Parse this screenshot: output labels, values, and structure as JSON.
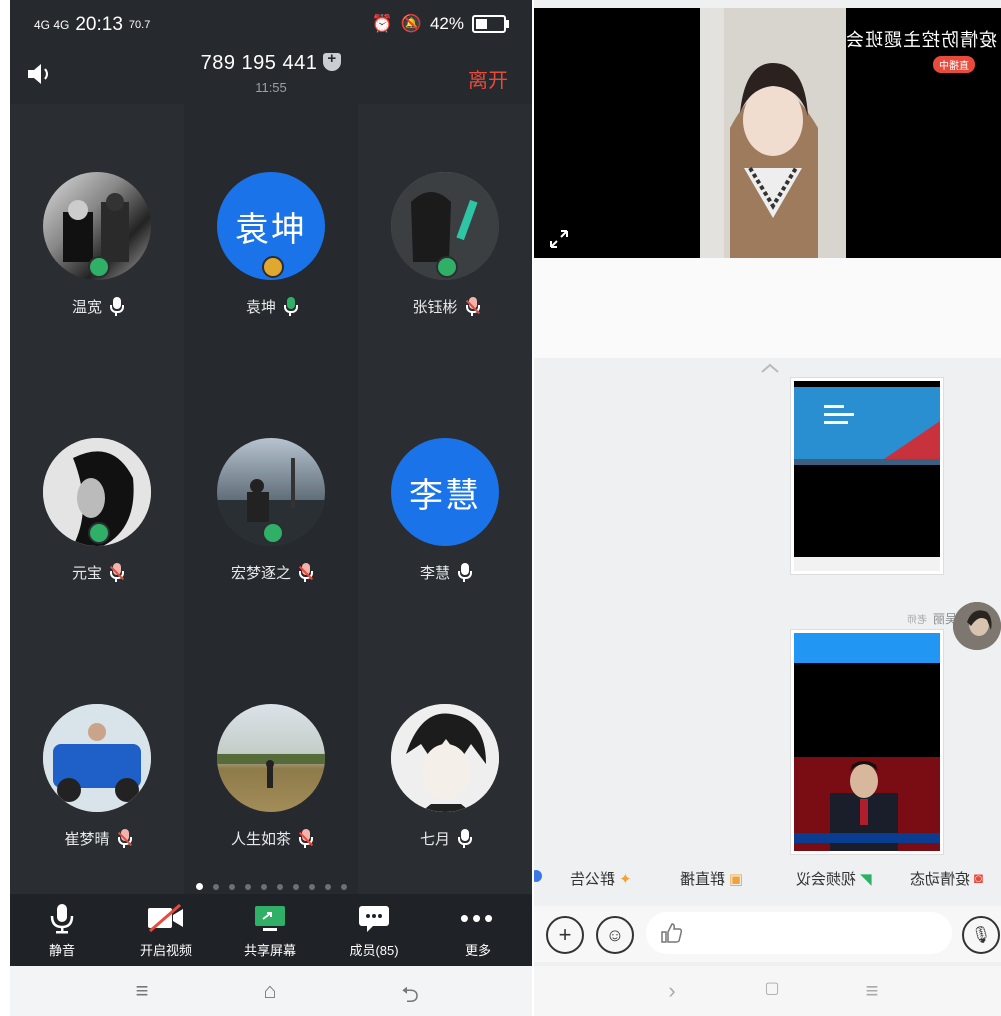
{
  "left": {
    "status": {
      "network": "4G 4G",
      "time": "20:13",
      "speed": "70.7",
      "battery": "42%"
    },
    "header": {
      "meeting_id": "789 195 441",
      "elapsed": "11:55",
      "leave": "离开"
    },
    "participants": [
      {
        "name": "温宽",
        "avatar_text": "",
        "mic": "on",
        "role": "host"
      },
      {
        "name": "袁坤",
        "avatar_text": "袁坤",
        "mic": "on-green",
        "role": "cohost"
      },
      {
        "name": "张钰彬",
        "avatar_text": "",
        "mic": "muted",
        "role": "host"
      },
      {
        "name": "元宝",
        "avatar_text": "",
        "mic": "muted",
        "role": "host"
      },
      {
        "name": "宏梦逐之",
        "avatar_text": "",
        "mic": "muted",
        "role": "host"
      },
      {
        "name": "李慧",
        "avatar_text": "李慧",
        "mic": "on",
        "role": ""
      },
      {
        "name": "崔梦晴",
        "avatar_text": "",
        "mic": "muted",
        "role": ""
      },
      {
        "name": "人生如茶",
        "avatar_text": "",
        "mic": "muted",
        "role": ""
      },
      {
        "name": "七月",
        "avatar_text": "",
        "mic": "on",
        "role": ""
      }
    ],
    "page_dots": 10,
    "active_dot": 0,
    "toolbar": {
      "mute": "静音",
      "video": "开启视频",
      "share": "共享屏幕",
      "members": "成员(85)",
      "more": "更多"
    },
    "colors": {
      "accent": "#1a73e8",
      "leave": "#e84a3c",
      "host": "#2fb066"
    }
  },
  "right": {
    "video_title": "疫情防控主题班会",
    "live_tag": "直播中",
    "quick_bar": [
      "疫情动态",
      "视频会议",
      "群直播",
      "群公告"
    ],
    "sender": {
      "name": "吴丽",
      "tag": "老师"
    }
  }
}
